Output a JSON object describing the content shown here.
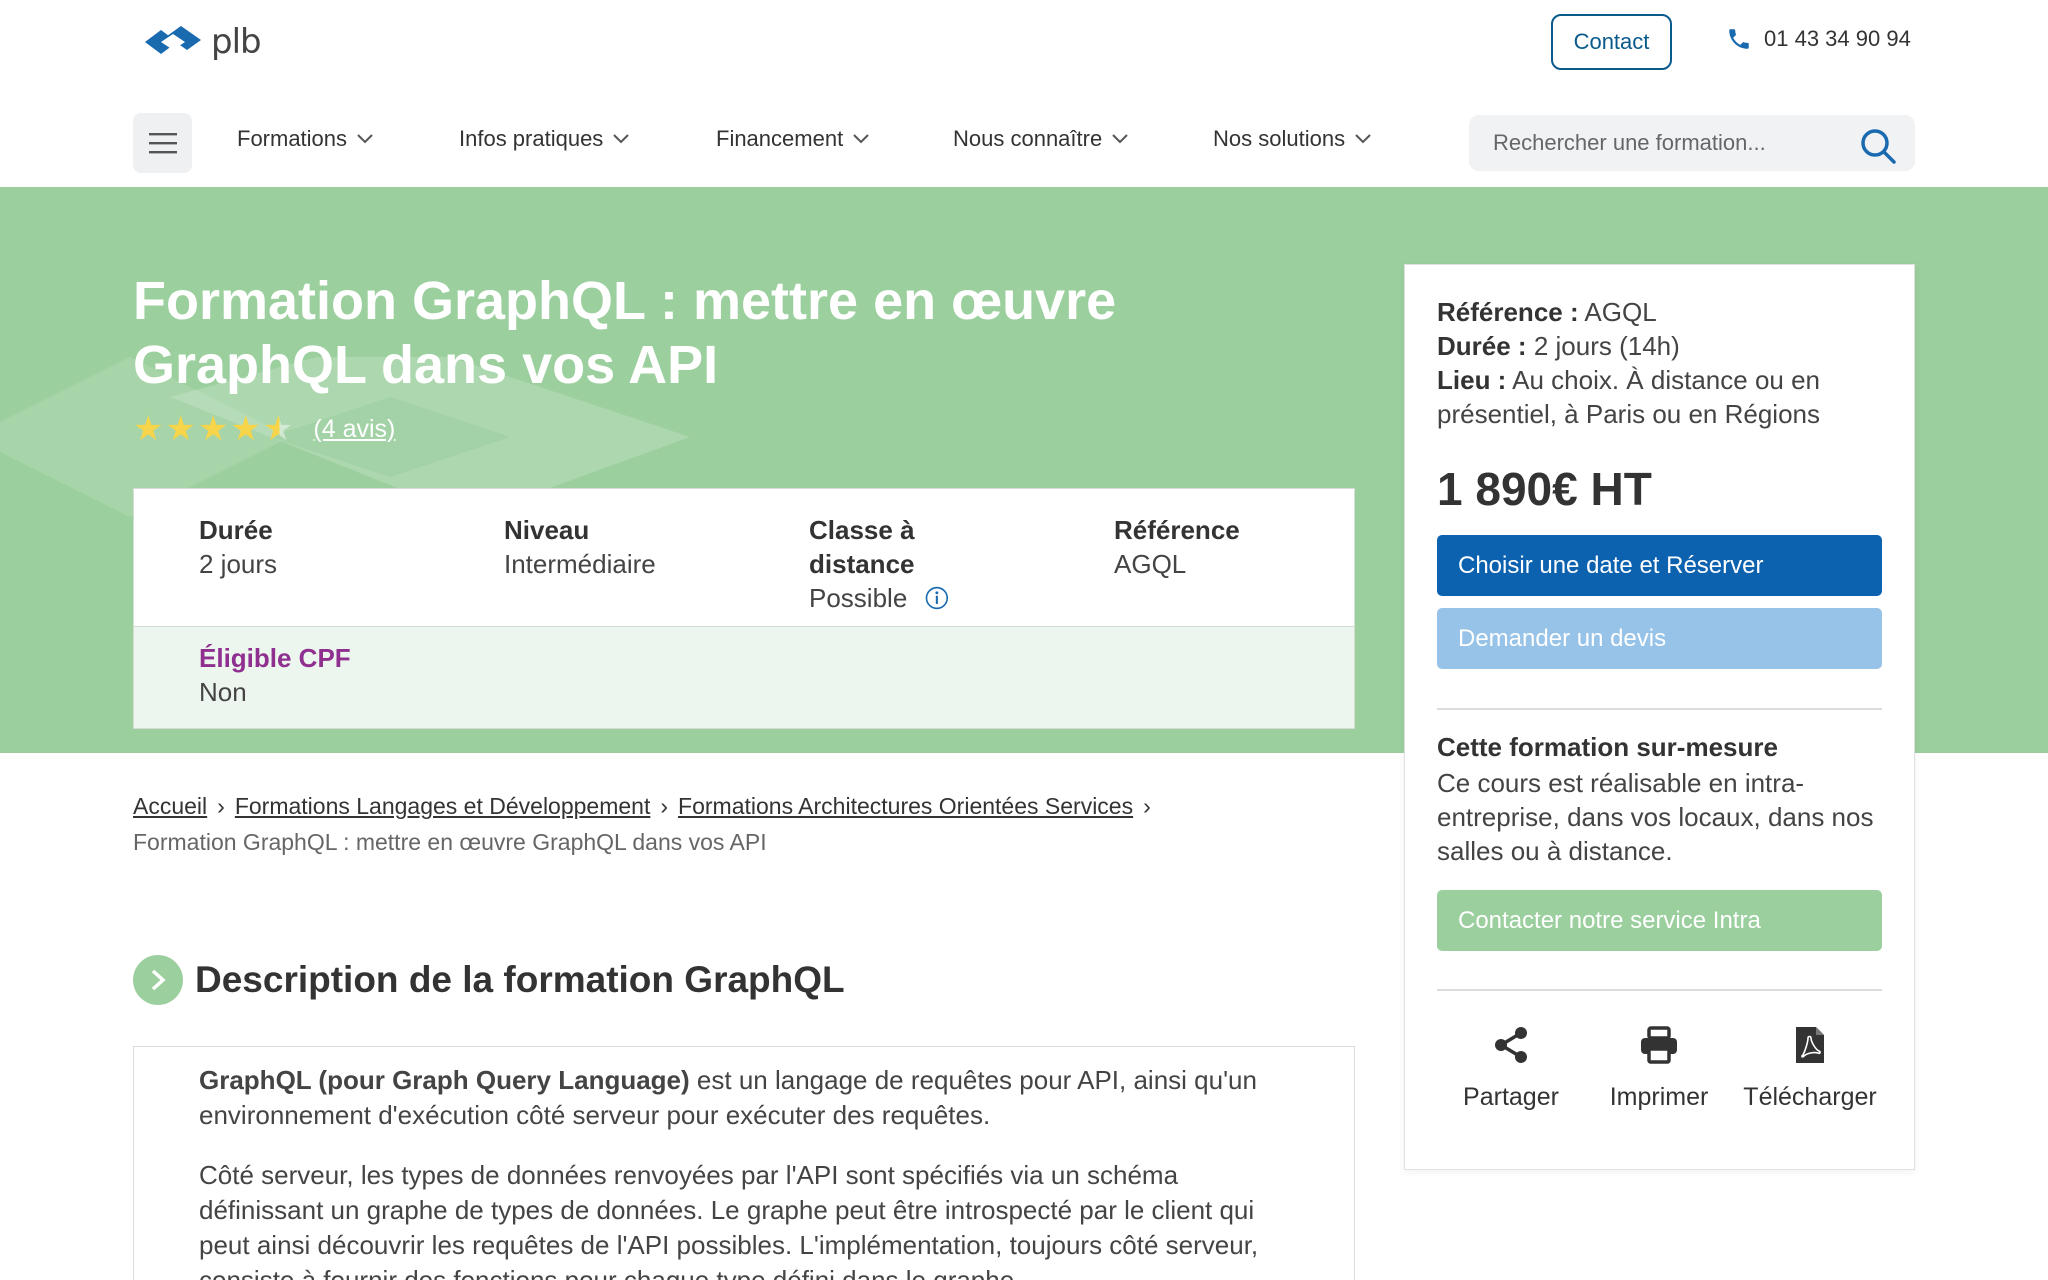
{
  "header": {
    "logo_text": "plb",
    "contact_label": "Contact",
    "phone": "01 43 34 90 94"
  },
  "nav": {
    "items": [
      {
        "label": "Formations"
      },
      {
        "label": "Infos pratiques"
      },
      {
        "label": "Financement"
      },
      {
        "label": "Nous connaître"
      },
      {
        "label": "Nos solutions"
      }
    ],
    "search_placeholder": "Rechercher une formation..."
  },
  "hero": {
    "title": "Formation GraphQL : mettre en œuvre GraphQL dans vos API",
    "rating": 4.5,
    "reviews_label": "(4 avis)"
  },
  "infobox": {
    "duree_label": "Durée",
    "duree_value": "2 jours",
    "niveau_label": "Niveau",
    "niveau_value": "Intermédiaire",
    "classe_label": "Classe à distance",
    "classe_value": "Possible",
    "reference_label": "Référence",
    "reference_value": "AGQL",
    "cpf_label": "Éligible CPF",
    "cpf_value": "Non"
  },
  "sidebar": {
    "ref_label": "Référence :",
    "ref_value": "AGQL",
    "duree_label": "Durée :",
    "duree_value": "2 jours (14h)",
    "lieu_label": "Lieu :",
    "lieu_value": "Au choix. À distance ou en présentiel, à Paris ou en Régions",
    "price": "1 890€ HT",
    "reserve_label": "Choisir une date et Réserver",
    "devis_label": "Demander un devis",
    "intra_title": "Cette formation sur-mesure",
    "intra_text": "Ce cours est réalisable en intra-entreprise, dans vos locaux, dans nos salles ou à distance.",
    "intra_button": "Contacter notre service Intra",
    "share_label": "Partager",
    "print_label": "Imprimer",
    "download_label": "Télécharger"
  },
  "breadcrumb": {
    "items": [
      {
        "label": "Accueil"
      },
      {
        "label": "Formations Langages et Développement"
      },
      {
        "label": "Formations Architectures Orientées Services"
      }
    ],
    "current": "Formation GraphQL : mettre en œuvre GraphQL dans vos API"
  },
  "description": {
    "title": "Description de la formation GraphQL",
    "p1_bold": "GraphQL (pour Graph Query Language)",
    "p1_rest": " est un langage de requêtes pour API, ainsi qu'un environnement d'exécution côté serveur pour exécuter des requêtes.",
    "p2": "Côté serveur, les types de données renvoyées par l'API sont spécifiés via un schéma définissant un graphe de types de données. Le graphe peut être introspecté par le client qui peut ainsi découvrir les requêtes de l'API possibles. L'implémentation, toujours côté serveur, consiste à fournir des fonctions pour chaque type défini dans le graphe."
  },
  "colors": {
    "hero_green": "#9bcf9e",
    "primary_blue": "#0d62b0",
    "light_blue": "#97c3e8",
    "cpf_purple": "#8f2f8f"
  }
}
